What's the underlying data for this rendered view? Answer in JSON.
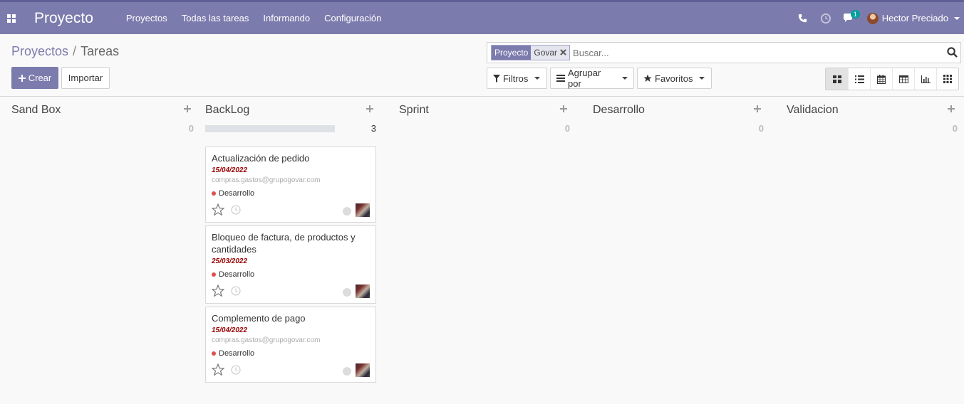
{
  "navbar": {
    "brand": "Proyecto",
    "menu": [
      "Proyectos",
      "Todas las tareas",
      "Informando",
      "Configuración"
    ],
    "messages_badge": "1",
    "user_name": "Hector Preciado",
    "background_color": "#7c7bad"
  },
  "breadcrumb": {
    "parent": "Proyectos",
    "separator": "/",
    "current": "Tareas"
  },
  "buttons": {
    "create": "Crear",
    "import": "Importar"
  },
  "search": {
    "facet_label": "Proyecto",
    "facet_value": "Govar",
    "placeholder": "Buscar..."
  },
  "filters": {
    "filters_label": "Filtros",
    "group_by_label": "Agrupar por",
    "favorites_label": "Favoritos"
  },
  "views": {
    "active": "kanban",
    "icons": [
      "kanban-view-icon",
      "list-view-icon",
      "calendar-view-icon",
      "pivot-view-icon",
      "graph-view-icon",
      "activity-view-icon"
    ]
  },
  "columns": [
    {
      "title": "Sand Box",
      "count": "0"
    },
    {
      "title": "BackLog",
      "count": "3"
    },
    {
      "title": "Sprint",
      "count": "0"
    },
    {
      "title": "Desarrollo",
      "count": "0"
    },
    {
      "title": "Validacion",
      "count": "0"
    }
  ],
  "cards": [
    {
      "title": "Actualización de pedido",
      "date": "15/04/2022",
      "email": "compras.gastos@grupogovar.com",
      "tag": "Desarrollo"
    },
    {
      "title": "Bloqueo de factura, de productos y cantidades",
      "date": "25/03/2022",
      "email": "",
      "tag": "Desarrollo"
    },
    {
      "title": "Complemento de pago",
      "date": "15/04/2022",
      "email": "compras.gastos@grupogovar.com",
      "tag": "Desarrollo"
    }
  ]
}
